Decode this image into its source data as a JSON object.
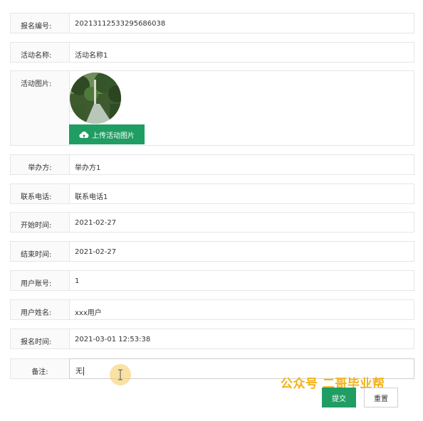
{
  "form": {
    "fields": [
      {
        "label": "报名编号:",
        "value": "20213112533295686038"
      },
      {
        "label": "活动名称:",
        "value": "活动名称1"
      },
      {
        "label": "活动图片:"
      },
      {
        "label": "举办方:",
        "value": "举办方1"
      },
      {
        "label": "联系电话:",
        "value": "联系电话1"
      },
      {
        "label": "开始时间:",
        "value": "2021-02-27"
      },
      {
        "label": "结束时间:",
        "value": "2021-02-27"
      },
      {
        "label": "用户账号:",
        "value": "1"
      },
      {
        "label": "用户姓名:",
        "value": "xxx用户"
      },
      {
        "label": "报名时间:",
        "value": "2021-03-01 12:53:38"
      },
      {
        "label": "备注:",
        "value": "无"
      }
    ],
    "upload_label": "上传活动图片",
    "submit_label": "提交",
    "reset_label": "重置"
  },
  "watermark": "公众号 二哥毕业帮",
  "colors": {
    "primary": "#1f9d63",
    "watermark": "#f2b21c"
  }
}
